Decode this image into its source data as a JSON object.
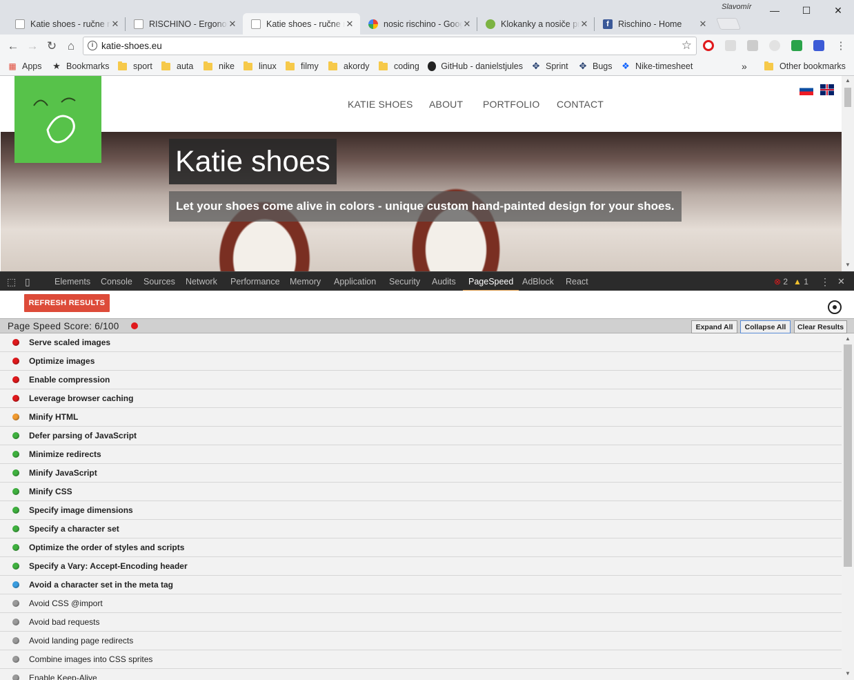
{
  "user": "Slavomír",
  "tabs": [
    {
      "title": "Katie shoes - ručne maľované topánky",
      "active": false
    },
    {
      "title": "RISCHINO - Ergonomické nosiče",
      "active": false
    },
    {
      "title": "Katie shoes - ručne maľované topánky",
      "active": true
    },
    {
      "title": "nosic rischino - Google Search",
      "active": false
    },
    {
      "title": "Klokanky a nosiče pre deti",
      "active": false
    },
    {
      "title": "Rischino - Home",
      "active": false
    }
  ],
  "omnibox": {
    "url": "katie-shoes.eu"
  },
  "bookmarks": {
    "items": [
      "Apps",
      "Bookmarks",
      "sport",
      "auta",
      "nike",
      "linux",
      "filmy",
      "akordy",
      "coding",
      "GitHub - danielstjules",
      "Sprint",
      "Bugs",
      "Nike-timesheet"
    ],
    "overflow": "»",
    "other": "Other bookmarks"
  },
  "site": {
    "nav": [
      "KATIE SHOES",
      "ABOUT",
      "PORTFOLIO",
      "CONTACT"
    ],
    "hero_title": "Katie shoes",
    "hero_subtitle": "Let your shoes come alive in colors - unique custom hand-painted design for your shoes."
  },
  "devtools": {
    "tabs": [
      "Elements",
      "Console",
      "Sources",
      "Network",
      "Performance",
      "Memory",
      "Application",
      "Security",
      "Audits",
      "PageSpeed",
      "AdBlock",
      "React"
    ],
    "active_tab": "PageSpeed",
    "errors": "2",
    "warnings": "1"
  },
  "pagespeed": {
    "refresh_label": "REFRESH RESULTS",
    "score_label": "Page Speed Score: 6/100",
    "buttons": {
      "expand": "Expand All",
      "collapse": "Collapse All",
      "clear": "Clear Results"
    },
    "status_colors": {
      "red": "#e0191c",
      "orange": "#f29b30",
      "green": "#3fb13f",
      "blue": "#3a9de0",
      "gray": "#9a9a9a"
    },
    "rules": [
      {
        "label": "Serve scaled images",
        "status": "red"
      },
      {
        "label": "Optimize images",
        "status": "red"
      },
      {
        "label": "Enable compression",
        "status": "red"
      },
      {
        "label": "Leverage browser caching",
        "status": "red"
      },
      {
        "label": "Minify HTML",
        "status": "orange"
      },
      {
        "label": "Defer parsing of JavaScript",
        "status": "green"
      },
      {
        "label": "Minimize redirects",
        "status": "green"
      },
      {
        "label": "Minify JavaScript",
        "status": "green"
      },
      {
        "label": "Minify CSS",
        "status": "green"
      },
      {
        "label": "Specify image dimensions",
        "status": "green"
      },
      {
        "label": "Specify a character set",
        "status": "green"
      },
      {
        "label": "Optimize the order of styles and scripts",
        "status": "green"
      },
      {
        "label": "Specify a Vary: Accept-Encoding header",
        "status": "green"
      },
      {
        "label": "Avoid a character set in the meta tag",
        "status": "blue"
      },
      {
        "label": "Avoid CSS @import",
        "status": "gray"
      },
      {
        "label": "Avoid bad requests",
        "status": "gray"
      },
      {
        "label": "Avoid landing page redirects",
        "status": "gray"
      },
      {
        "label": "Combine images into CSS sprites",
        "status": "gray"
      },
      {
        "label": "Enable Keep-Alive",
        "status": "gray"
      }
    ]
  }
}
